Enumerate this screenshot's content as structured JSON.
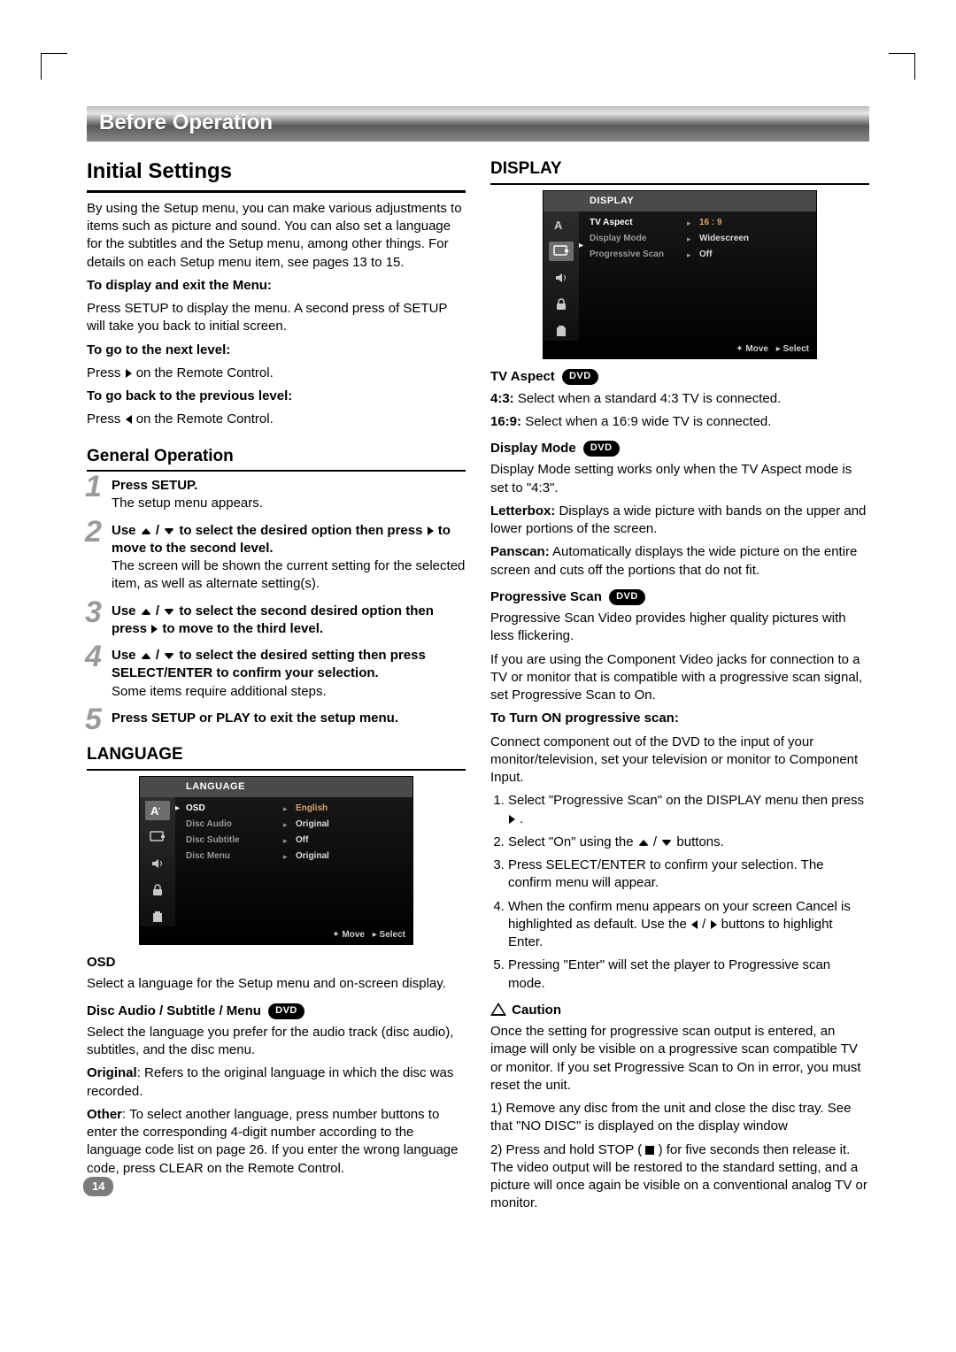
{
  "page_number": "14",
  "section_header": "Before Operation",
  "left": {
    "h_initial": "Initial Settings",
    "intro": "By using the Setup menu, you can make various adjustments to items such as picture and sound. You can also set a language for the subtitles and the Setup menu, among other things. For details on each Setup menu item, see pages 13 to 15.",
    "display_exit_h": "To display and exit the Menu:",
    "display_exit_p": "Press SETUP to display the menu. A second press of SETUP will take you back to initial screen.",
    "next_level_h": "To go to the next level:",
    "next_level_p_pre": "Press ",
    "next_level_p_post": " on the Remote Control.",
    "prev_level_h": "To go back to the previous level:",
    "prev_level_p_pre": "Press ",
    "prev_level_p_post": " on the Remote Control.",
    "h_general": "General Operation",
    "steps": {
      "s1b": "Press SETUP.",
      "s1p": "The setup menu appears.",
      "s2b_pre": "Use ",
      "s2b_mid": " / ",
      "s2b_post": " to select the desired option then press ",
      "s2b_end": " to move to the second level.",
      "s2p": "The screen will be shown the current setting for the selected item, as well as alternate setting(s).",
      "s3b_pre": "Use ",
      "s3b_mid": " / ",
      "s3b_post": " to select the second desired option then press ",
      "s3b_end": " to move to the third level.",
      "s4b_pre": "Use ",
      "s4b_mid": " / ",
      "s4b_post": " to select the desired setting then press SELECT/ENTER to confirm your selection.",
      "s4p": "Some items require additional steps.",
      "s5b": "Press SETUP or PLAY to exit the setup menu."
    },
    "h_language": "LANGUAGE",
    "osd_lang": {
      "title": "LANGUAGE",
      "rows": [
        {
          "label": "OSD",
          "value": "English",
          "sel": true
        },
        {
          "label": "Disc Audio",
          "value": "Original"
        },
        {
          "label": "Disc Subtitle",
          "value": "Off"
        },
        {
          "label": "Disc Menu",
          "value": "Original"
        }
      ],
      "footer_move": "Move",
      "footer_select": "Select"
    },
    "osd_h": "OSD",
    "osd_p": "Select a language for the Setup menu and on-screen display.",
    "disc_h": "Disc Audio / Subtitle / Menu",
    "disc_p": "Select the language you prefer for the audio track (disc audio), subtitles, and the disc menu.",
    "orig_b": "Original",
    "orig_p": ": Refers to the original language in which the disc was recorded.",
    "other_b": "Other",
    "other_p": ": To select another language, press number buttons to enter the corresponding 4-digit number according to the language code list on page 26. If you enter the wrong language code, press CLEAR on the Remote Control."
  },
  "right": {
    "h_display": "DISPLAY",
    "osd_disp": {
      "title": "DISPLAY",
      "rows": [
        {
          "label": "TV Aspect",
          "value": "16 : 9",
          "sel": true
        },
        {
          "label": "Display Mode",
          "value": "Widescreen"
        },
        {
          "label": "Progressive Scan",
          "value": "Off"
        }
      ],
      "footer_move": "Move",
      "footer_select": "Select"
    },
    "tv_h": "TV Aspect",
    "tv_43b": "4:3:",
    "tv_43p": " Select when a standard 4:3 TV is connected.",
    "tv_169b": "16:9:",
    "tv_169p": " Select when a 16:9 wide TV is connected.",
    "dm_h": "Display Mode",
    "dm_p": "Display Mode setting works only when the TV Aspect mode is set to \"4:3\".",
    "lb_b": "Letterbox:",
    "lb_p": " Displays a wide picture with bands on the upper and lower portions of the screen.",
    "ps_b": "Panscan:",
    "ps_p": " Automatically displays the wide picture on the entire screen and cuts off the portions that do not fit.",
    "psc_h": "Progressive Scan",
    "psc_p1": "Progressive Scan Video provides higher quality pictures with less flickering.",
    "psc_p2": "If you are using the Component Video jacks for connection to a TV or monitor that is compatible with a progressive scan signal, set Progressive Scan to On.",
    "psc_on_h": "To Turn ON progressive scan:",
    "psc_on_p": "Connect component out of the DVD to the input of your monitor/television, set your television or monitor to Component Input.",
    "list": {
      "l1_pre": "Select \"Progressive Scan\" on the DISPLAY menu then press ",
      "l1_post": ".",
      "l2_pre": "Select \"On\" using the ",
      "l2_mid": " / ",
      "l2_post": " buttons.",
      "l3": "Press SELECT/ENTER to confirm your selection. The confirm menu will appear.",
      "l4_pre": "When the confirm menu appears on your screen Cancel is highlighted as default. Use the ",
      "l4_mid": " / ",
      "l4_post": " buttons to highlight Enter.",
      "l5": "Pressing \"Enter\" will set the player to Progressive scan mode."
    },
    "caution_h": "Caution",
    "caution_p": "Once the setting for progressive scan output is entered, an image will only be visible on a progressive scan compatible TV or monitor. If you set Progressive Scan to On in error, you must reset the unit.",
    "c1": "Remove any disc from the unit and close the disc tray. See that \"NO DISC\" is displayed on the display window",
    "c2_pre": "Press and hold STOP (",
    "c2_post": ") for five seconds then release it. The video output will be restored to the standard setting, and a picture will once again be visible on a conventional analog TV or monitor."
  },
  "badge_dvd": "DVD"
}
